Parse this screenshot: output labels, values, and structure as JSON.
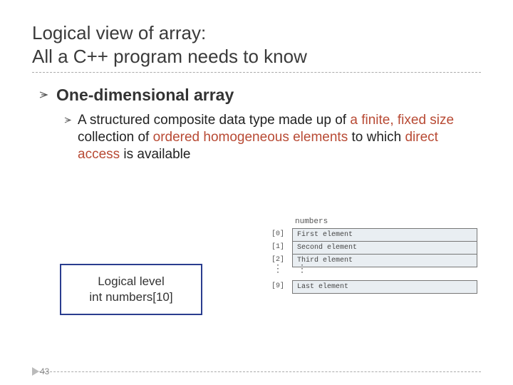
{
  "title_line1": "Logical view of array:",
  "title_line2": "All a C++ program needs to know",
  "heading": "One-dimensional array",
  "body_parts": {
    "p1": "A structured composite data type made up of ",
    "hl1": "a finite, fixed size",
    "p2": " collection of ",
    "hl2": "ordered homogeneous elements",
    "p3": " to which ",
    "hl3": "direct access",
    "p4": " is available"
  },
  "logical_box": {
    "line1": "Logical level",
    "line2": "int numbers[10]"
  },
  "diagram": {
    "header": "numbers",
    "rows": [
      {
        "idx": "[0]",
        "label": "First element"
      },
      {
        "idx": "[1]",
        "label": "Second element"
      },
      {
        "idx": "[2]",
        "label": "Third element"
      }
    ],
    "last": {
      "idx": "[9]",
      "label": "Last element"
    }
  },
  "page_number": "43"
}
